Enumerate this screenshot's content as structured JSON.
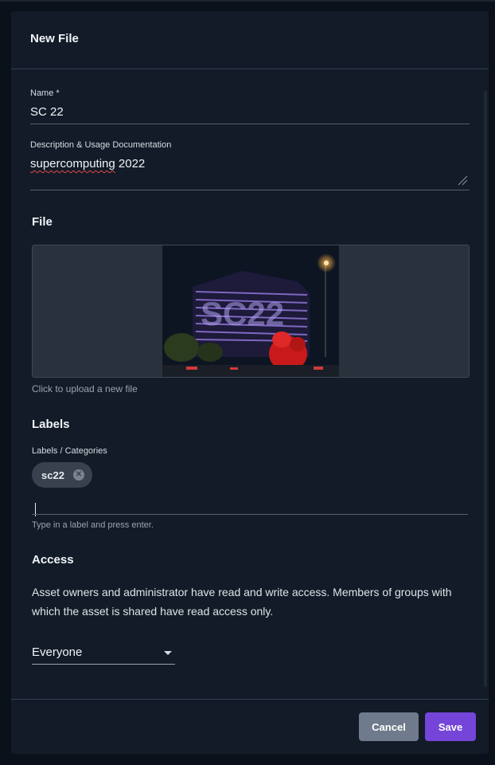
{
  "dialog": {
    "title": "New File"
  },
  "name_field": {
    "label": "Name *",
    "value": "SC 22"
  },
  "description_field": {
    "label": "Description & Usage Documentation",
    "value_misspelled": "supercomputing",
    "value_rest": " 2022"
  },
  "file_section": {
    "title": "File",
    "upload_hint": "Click to upload a new file",
    "preview_overlay_text": "SC22"
  },
  "labels_section": {
    "title": "Labels",
    "field_label": "Labels / Categories",
    "chips": [
      {
        "label": "sc22"
      }
    ],
    "hint": "Type in a label and press enter."
  },
  "access_section": {
    "title": "Access",
    "description": "Asset owners and administrator have read and write access. Members of groups with which the asset is shared have read access only.",
    "select_value": "Everyone"
  },
  "footer": {
    "cancel_label": "Cancel",
    "save_label": "Save"
  },
  "colors": {
    "background": "#121b27",
    "primary": "#7445d8",
    "secondary_button": "#6f7a8c"
  }
}
